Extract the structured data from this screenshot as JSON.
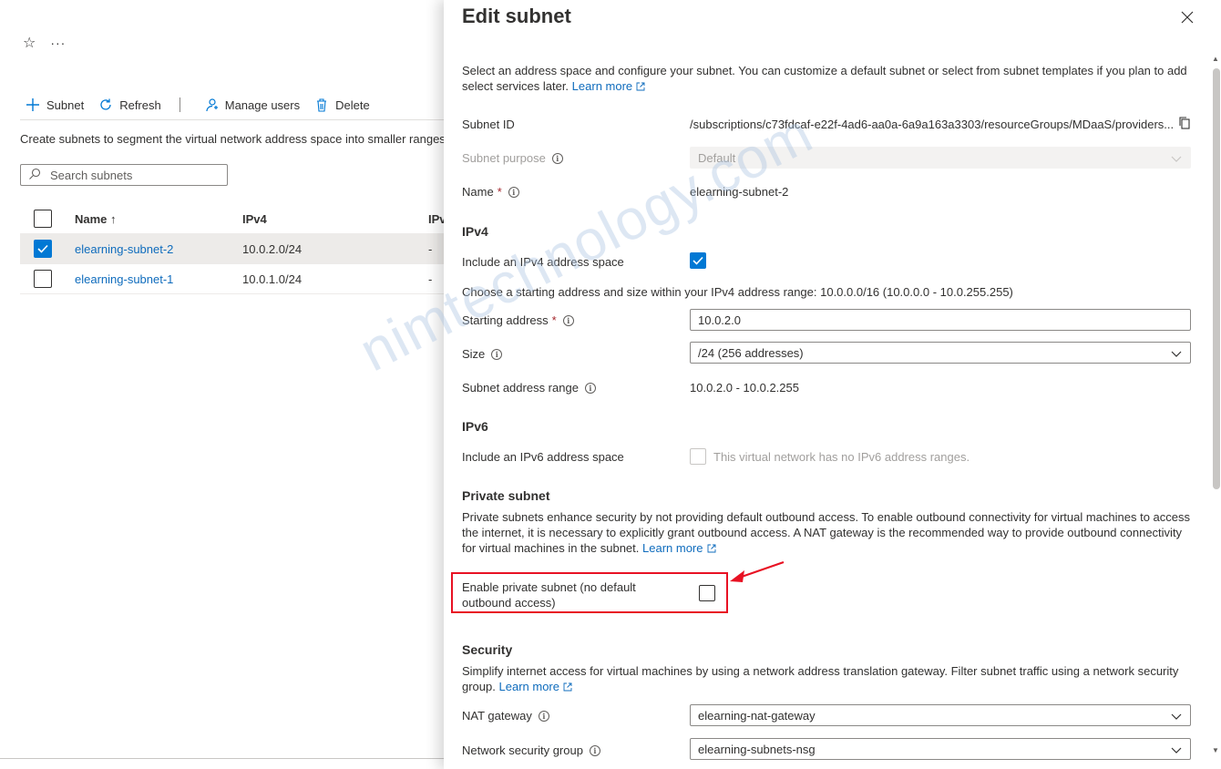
{
  "left": {
    "toolbar": {
      "subnet_label": "Subnet",
      "refresh_label": "Refresh",
      "manage_users_label": "Manage users",
      "delete_label": "Delete"
    },
    "description": "Create subnets to segment the virtual network address space into smaller ranges",
    "search_placeholder": "Search subnets",
    "grid": {
      "headers": {
        "name": "Name ↑",
        "ipv4": "IPv4",
        "ipv6": "IPv"
      },
      "rows": [
        {
          "name": "elearning-subnet-2",
          "ipv4": "10.0.2.0/24",
          "ipv6": "-",
          "selected": true
        },
        {
          "name": "elearning-subnet-1",
          "ipv4": "10.0.1.0/24",
          "ipv6": "-",
          "selected": false
        }
      ]
    }
  },
  "panel": {
    "title": "Edit subnet",
    "intro": "Select an address space and configure your subnet. You can customize a default subnet or select from subnet templates if you plan to add select services later.",
    "learn_more": "Learn more",
    "subnet_id_label": "Subnet ID",
    "subnet_id_value": "/subscriptions/c73fdcaf-e22f-4ad6-aa0a-6a9a163a3303/resourceGroups/MDaaS/providers...",
    "subnet_purpose_label": "Subnet purpose",
    "subnet_purpose_value": "Default",
    "name_label": "Name",
    "name_value": "elearning-subnet-2",
    "ipv4": {
      "section": "IPv4",
      "include_label": "Include an IPv4 address space",
      "include_checked": true,
      "range_text": "Choose a starting address and size within your IPv4 address range: 10.0.0.0/16 (10.0.0.0 - 10.0.255.255)",
      "starting_address_label": "Starting address",
      "starting_address_value": "10.0.2.0",
      "size_label": "Size",
      "size_value": "/24 (256 addresses)",
      "range_label": "Subnet address range",
      "range_value": "10.0.2.0 - 10.0.2.255"
    },
    "ipv6": {
      "section": "IPv6",
      "include_label": "Include an IPv6 address space",
      "disabled_note": "This virtual network has no IPv6 address ranges."
    },
    "private_subnet": {
      "section": "Private subnet",
      "description": "Private subnets enhance security by not providing default outbound access. To enable outbound connectivity for virtual machines to access the internet, it is necessary to explicitly grant outbound access. A NAT gateway is the recommended way to provide outbound connectivity for virtual machines in the subnet.",
      "learn_more": "Learn more",
      "enable_label": "Enable private subnet (no default outbound access)",
      "enable_checked": false
    },
    "security": {
      "section": "Security",
      "description": "Simplify internet access for virtual machines by using a network address translation gateway. Filter subnet traffic using a network security group.",
      "learn_more": "Learn more",
      "nat_label": "NAT gateway",
      "nat_value": "elearning-nat-gateway",
      "nsg_label": "Network security group",
      "nsg_value": "elearning-subnets-nsg"
    }
  },
  "watermark": "nimtechnology.com",
  "colors": {
    "accent": "#0078d4",
    "link": "#0f6cbd",
    "highlight": "#e81123",
    "required": "#a4262c"
  }
}
